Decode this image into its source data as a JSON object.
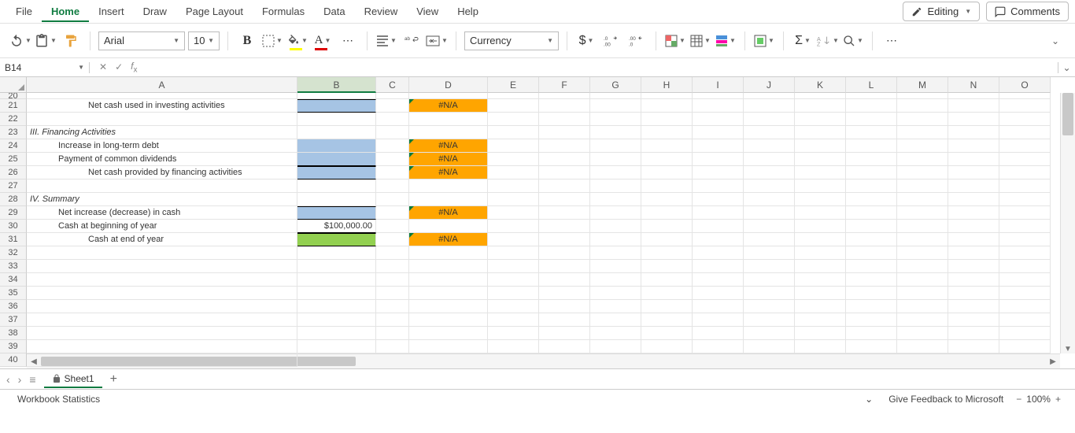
{
  "tabs": [
    "File",
    "Home",
    "Insert",
    "Draw",
    "Page Layout",
    "Formulas",
    "Data",
    "Review",
    "View",
    "Help"
  ],
  "active_tab": "Home",
  "editing_label": "Editing",
  "comments_label": "Comments",
  "font_name": "Arial",
  "font_size": "10",
  "number_format": "Currency",
  "namebox": "B14",
  "formula": "",
  "columns": [
    "A",
    "B",
    "C",
    "D",
    "E",
    "F",
    "G",
    "H",
    "I",
    "J",
    "K",
    "L",
    "M",
    "N",
    "O"
  ],
  "selected_col": "B",
  "row_start": 20,
  "rows": [
    {
      "n": 20,
      "A": "",
      "B_class": "",
      "D": "",
      "D_class": ""
    },
    {
      "n": 21,
      "A": "Net cash used in investing activities",
      "A_pad": 78,
      "B_class": "blue blue-tb",
      "D": "#N/A",
      "D_class": "orange err-tri"
    },
    {
      "n": 22,
      "A": ""
    },
    {
      "n": 23,
      "A": "III.  Financing Activities",
      "A_italic": true,
      "A_pad": 4
    },
    {
      "n": 24,
      "A": "Increase in long-term debt",
      "A_pad": 40,
      "B_class": "blue",
      "D": "#N/A",
      "D_class": "orange err-tri"
    },
    {
      "n": 25,
      "A": "Payment of common dividends",
      "A_pad": 40,
      "B_class": "blue",
      "B_bb": true,
      "D": "#N/A",
      "D_class": "orange err-tri"
    },
    {
      "n": 26,
      "A": "Net cash provided by financing activities",
      "A_pad": 78,
      "B_class": "blue blue-tb",
      "D": "#N/A",
      "D_class": "orange err-tri"
    },
    {
      "n": 27,
      "A": ""
    },
    {
      "n": 28,
      "A": "IV.  Summary",
      "A_italic": true,
      "A_pad": 4
    },
    {
      "n": 29,
      "A": "Net increase (decrease) in cash",
      "A_pad": 40,
      "B_class": "blue blue-tb",
      "D": "#N/A",
      "D_class": "orange err-tri"
    },
    {
      "n": 30,
      "A": "Cash at beginning of year",
      "A_pad": 40,
      "B": "$100,000.00",
      "B_right": true,
      "B_bb": true
    },
    {
      "n": 31,
      "A": "Cash at end of year",
      "A_pad": 78,
      "B_class": "green blue-tb",
      "D": "#N/A",
      "D_class": "orange err-tri"
    },
    {
      "n": 32,
      "A": ""
    },
    {
      "n": 33,
      "A": ""
    },
    {
      "n": 34,
      "A": ""
    },
    {
      "n": 35,
      "A": ""
    },
    {
      "n": 36,
      "A": ""
    },
    {
      "n": 37,
      "A": ""
    },
    {
      "n": 38,
      "A": ""
    },
    {
      "n": 39,
      "A": ""
    },
    {
      "n": 40,
      "A": ""
    }
  ],
  "sheet_name": "Sheet1",
  "status_left": "Workbook Statistics",
  "status_feedback": "Give Feedback to Microsoft",
  "zoom": "100%"
}
